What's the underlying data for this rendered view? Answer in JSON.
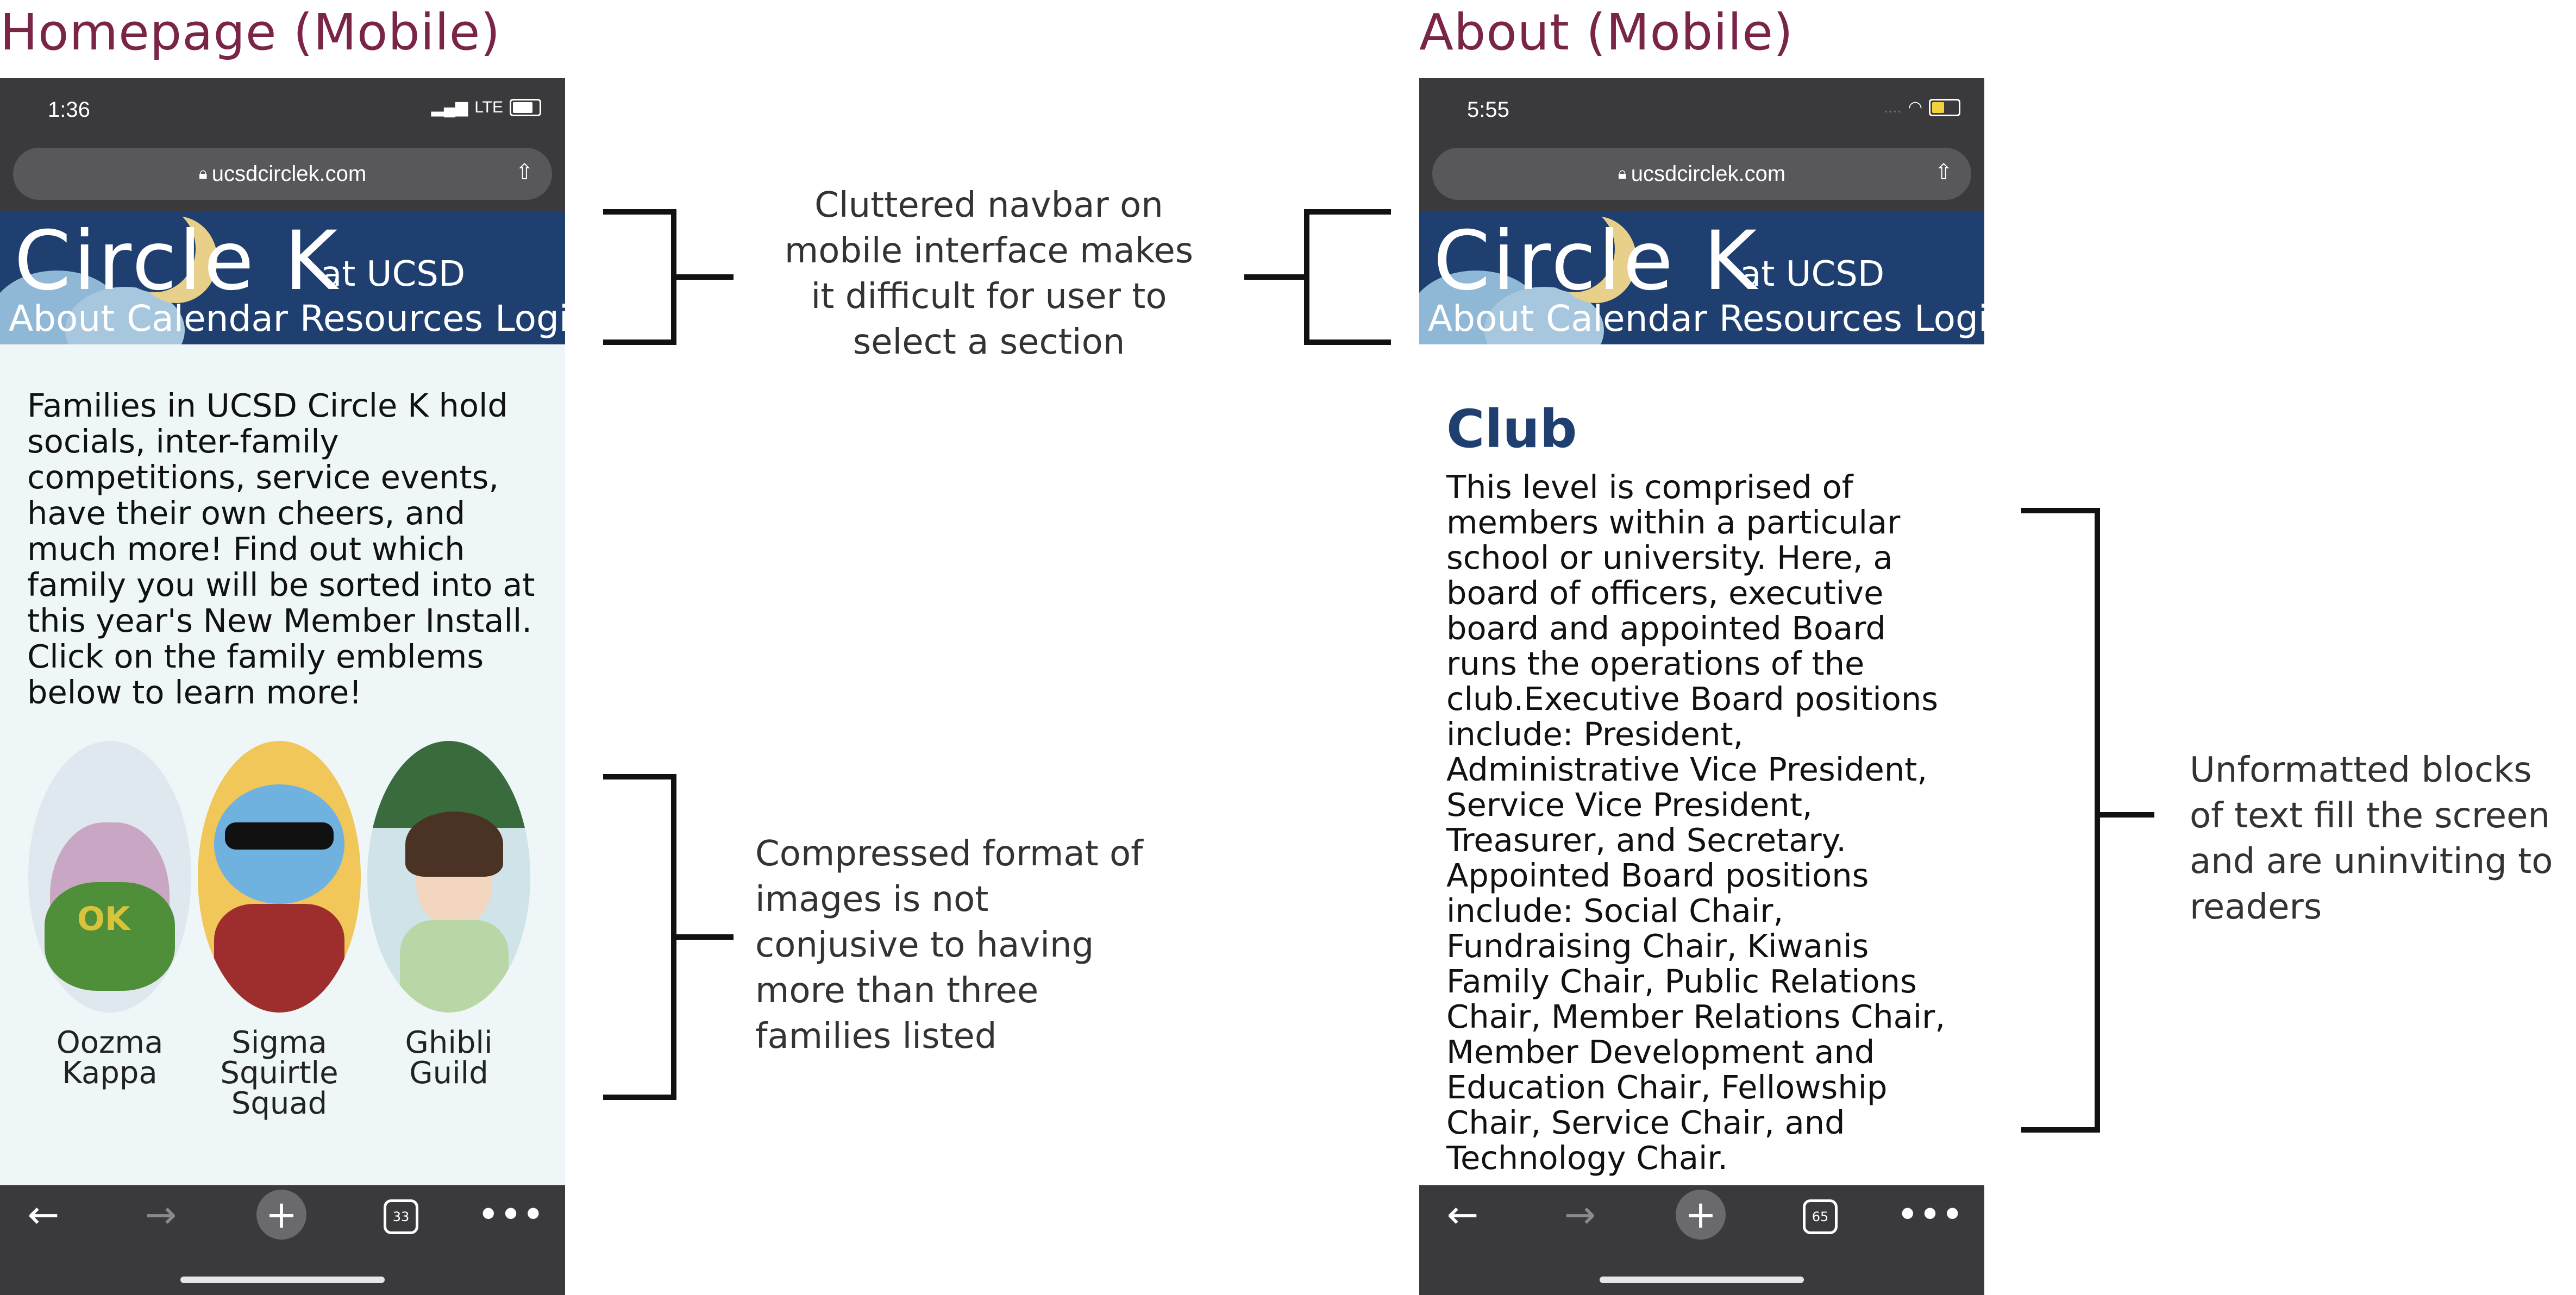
{
  "left_title": "Homepage (Mobile)",
  "right_title": "About (Mobile)",
  "homepage": {
    "time": "1:36",
    "network": "LTE",
    "url": "ucsdcirclek.com",
    "logo_main": "Circle K",
    "logo_sub": "at UCSD",
    "nav": [
      "About",
      "Calendar",
      "Resources",
      "Login"
    ],
    "intro": "Families in UCSD Circle K hold socials, inter-family competitions, service events, have their own cheers, and much more! Find out which family you will be sorted into at this year's New Member Install. Click on the family emblems below to learn more!",
    "families": [
      {
        "name": "Oozma Kappa",
        "color": "#dfe8ee",
        "accent": "#4f8f3a"
      },
      {
        "name": "Sigma Squirtle Squad",
        "color": "#f1c75a",
        "accent": "#3b7fc0"
      },
      {
        "name": "Ghibli Guild",
        "color": "#cfe3e8",
        "accent": "#3a6b3c"
      }
    ],
    "tab_count": "33"
  },
  "about": {
    "time": "5:55",
    "url": "ucsdcirclek.com",
    "logo_main": "Circle K",
    "logo_sub": "at UCSD",
    "nav": [
      "About",
      "Calendar",
      "Resources",
      "Login"
    ],
    "heading": "Club",
    "body": "This level is comprised of members within a particular school or university. Here, a board of officers, executive board and appointed Board runs the operations of the club.Executive Board positions include: President, Administrative Vice President, Service Vice President, Treasurer, and Secretary. Appointed Board positions include: Social Chair, Fundraising Chair, Kiwanis Family Chair, Public Relations Chair, Member Relations Chair, Member Development and Education Chair, Fellowship Chair, Service Chair, and Technology Chair.",
    "tab_count": "65"
  },
  "annotations": {
    "navbar": "Cluttered navbar on mobile interface makes it difficult for user to select a section",
    "images": "Compressed format of images is not conjusive to having more than three families listed",
    "text": "Unformatted blocks of text fill the screen and are uninviting to readers"
  },
  "colors": {
    "title": "#7a2448",
    "banner": "#1e3f6f",
    "content_bg": "#eef6f7",
    "bar": "#3a3a3c"
  }
}
